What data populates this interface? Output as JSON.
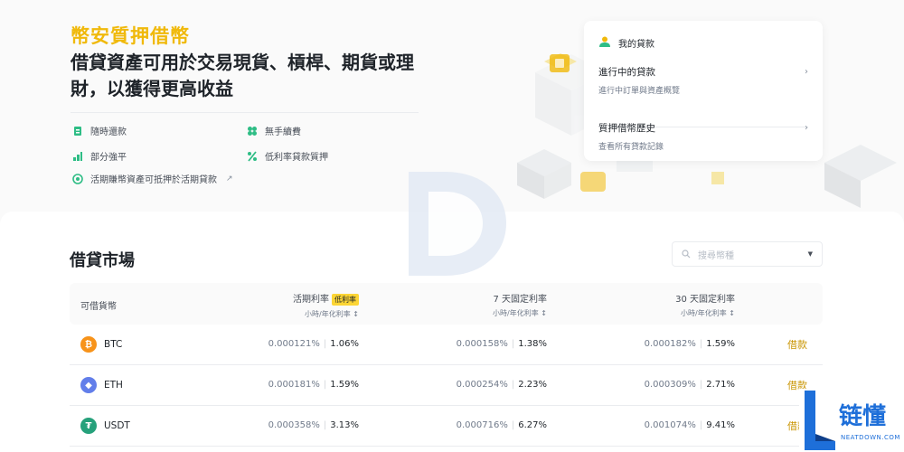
{
  "hero": {
    "title": "幣安質押借幣",
    "subtitle": "借貸資產可用於交易現貨、槓桿、期貨或理財，以獲得更高收益",
    "features": [
      {
        "icon": "repay-icon",
        "label": "隨時還款"
      },
      {
        "icon": "no-fee-icon",
        "label": "無手續費"
      },
      {
        "icon": "bar-chart-icon",
        "label": "部分強平"
      },
      {
        "icon": "percent-icon",
        "label": "低利率貸款質押"
      },
      {
        "icon": "flexible-icon",
        "label": "活期賺幣資產可抵押於活期貸款"
      }
    ]
  },
  "loan_card": {
    "title": "我的貸款",
    "items": [
      {
        "title": "進行中的貸款",
        "desc": "進行中訂單與資產概覽"
      },
      {
        "title": "質押借幣歷史",
        "desc": "查看所有貸款記錄"
      }
    ]
  },
  "market": {
    "title": "借貸市場",
    "search_placeholder": "搜尋幣種",
    "headers": {
      "coin": "可借貨幣",
      "flex": "活期利率",
      "flex_badge": "低利率",
      "d7": "7 天固定利率",
      "d30": "30 天固定利率",
      "sub": "小時/年化利率 ↕"
    },
    "rows": [
      {
        "coin": "BTC",
        "color": "#f7931a",
        "flex_h": "0.000121%",
        "flex_y": "1.06%",
        "d7_h": "0.000158%",
        "d7_y": "1.38%",
        "d30_h": "0.000182%",
        "d30_y": "1.59%",
        "action": "借款"
      },
      {
        "coin": "ETH",
        "color": "#627eea",
        "flex_h": "0.000181%",
        "flex_y": "1.59%",
        "d7_h": "0.000254%",
        "d7_y": "2.23%",
        "d30_h": "0.000309%",
        "d30_y": "2.71%",
        "action": "借款"
      },
      {
        "coin": "USDT",
        "color": "#26a17b",
        "flex_h": "0.000358%",
        "flex_y": "3.13%",
        "d7_h": "0.000716%",
        "d7_y": "6.27%",
        "d30_h": "0.001074%",
        "d30_y": "9.41%",
        "action": "借款"
      }
    ]
  },
  "brand": {
    "name": "链懂",
    "url": "NEATDOWN.COM",
    "accent": "#1e6fd9"
  }
}
